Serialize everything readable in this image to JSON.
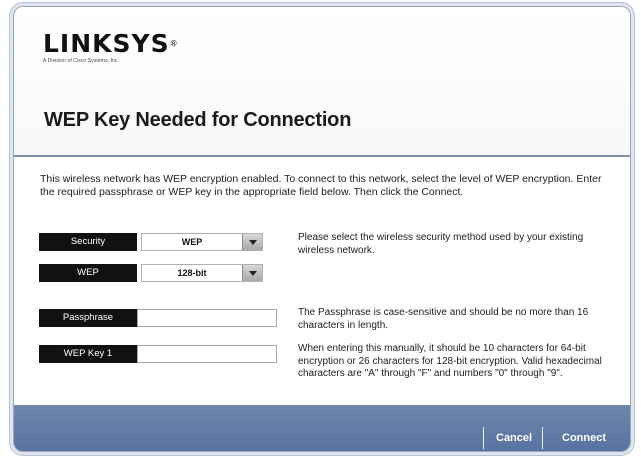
{
  "brand": {
    "name": "Linksys",
    "registered_mark": "®",
    "tagline": "A Division of Cisco Systems, Inc."
  },
  "dialog": {
    "title": "WEP Key Needed for Connection",
    "intro": "This wireless network has WEP encryption enabled. To connect to this network, select the level of WEP encryption. Enter the required passphrase or WEP key in the appropriate field below. Then click the Connect."
  },
  "form": {
    "security": {
      "label": "Security",
      "value": "WEP"
    },
    "wep": {
      "label": "WEP",
      "value": "128-bit"
    },
    "passphrase": {
      "label": "Passphrase",
      "value": ""
    },
    "wep_key_1": {
      "label": "WEP Key 1",
      "value": ""
    }
  },
  "help": {
    "security": "Please select the wireless security method used by your existing wireless network.",
    "passphrase": "The Passphrase is case-sensitive and should be no more than 16 characters in length.",
    "wep_key": "When entering this manually, it should be 10 characters for 64-bit encryption or 26 characters for 128-bit encryption. Valid hexadecimal characters are \"A\" through \"F\" and numbers \"0\" through \"9\"."
  },
  "footer": {
    "cancel_label": "Cancel",
    "connect_label": "Connect"
  }
}
